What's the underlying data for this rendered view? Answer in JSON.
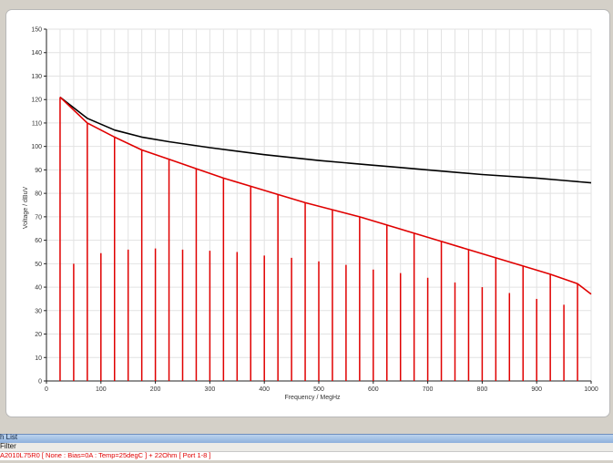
{
  "window": {
    "list_title": "h List",
    "filter_label": "Filter",
    "trace_entry": "A2010L75R0 [ None : Bias=0A : Temp=25degC ] + 22Ohm [ Port 1-8 ]"
  },
  "chart_data": {
    "type": "line",
    "xlabel": "Frequency / MegHz",
    "ylabel": "Voltage / dBuV",
    "xlim": [
      0,
      1000
    ],
    "ylim": [
      0,
      150
    ],
    "x_ticks": [
      0,
      100,
      200,
      300,
      400,
      500,
      600,
      700,
      800,
      900,
      1000
    ],
    "y_ticks": [
      0,
      10,
      20,
      30,
      40,
      50,
      60,
      70,
      80,
      90,
      100,
      110,
      120,
      130,
      140,
      150
    ],
    "grid": true,
    "colors": {
      "black_curve": "#000000",
      "red_envelope": "#e00000",
      "red_lines": "#e00000",
      "grid": "#e2e2e2"
    },
    "series": [
      {
        "color": "#000000",
        "x": [
          25,
          75,
          125,
          175,
          225,
          300,
          400,
          500,
          600,
          650,
          700,
          800,
          900,
          950,
          1000
        ],
        "y": [
          121,
          112,
          107,
          104,
          102,
          99.5,
          96.5,
          94,
          92,
          91,
          90,
          88,
          86.5,
          85.5,
          84.5
        ]
      },
      {
        "color": "#e00000",
        "x": [
          25,
          75,
          125,
          175,
          225,
          275,
          325,
          375,
          425,
          475,
          525,
          575,
          625,
          675,
          725,
          775,
          825,
          875,
          925,
          975,
          1000
        ],
        "y": [
          121,
          110,
          104,
          98.5,
          94.5,
          90.5,
          86.5,
          83,
          79.5,
          76,
          73,
          70,
          66.5,
          63,
          59.5,
          56,
          52.5,
          49,
          45.5,
          41.5,
          37
        ]
      }
    ],
    "spectral_lines": {
      "x": [
        25,
        50,
        75,
        100,
        125,
        150,
        175,
        200,
        225,
        250,
        275,
        300,
        325,
        350,
        375,
        400,
        425,
        450,
        475,
        500,
        525,
        550,
        575,
        600,
        625,
        650,
        675,
        700,
        725,
        750,
        775,
        800,
        825,
        850,
        875,
        900,
        925,
        950,
        975
      ],
      "y": [
        121,
        50,
        110,
        54.5,
        104,
        56,
        98.5,
        56.5,
        94.5,
        56,
        90.5,
        55.5,
        86.5,
        55,
        83,
        53.5,
        79.5,
        52.5,
        76,
        51,
        73,
        49.5,
        70,
        47.5,
        66.5,
        46,
        63,
        44,
        59.5,
        42,
        56,
        40,
        52.5,
        37.5,
        49,
        35,
        45.5,
        32.5,
        41.5
      ]
    }
  }
}
